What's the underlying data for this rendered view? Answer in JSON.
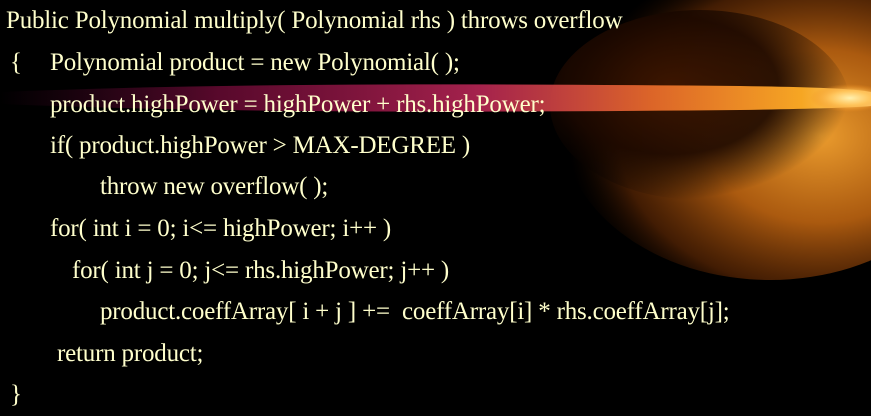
{
  "slide": {
    "colors": {
      "background": "#000000",
      "text": "#FFFFCC",
      "comet_core": "#FFD37A",
      "comet_mid": "#F39A1E",
      "comet_tail": "#B0125A"
    },
    "code_lines": [
      "Public Polynomial multiply( Polynomial rhs ) throws overflow",
      "{",
      "Polynomial product = new Polynomial( );",
      "product.highPower = highPower + rhs.highPower;",
      "if( product.highPower > MAX-DEGREE )",
      "throw new overflow( );",
      "for( int i = 0; i<= highPower; i++ )",
      "for( int j = 0; j<= rhs.highPower; j++ )",
      "product.coeffArray[ i + j ] +=  coeffArray[i] * rhs.coeffArray[j];",
      "return product;",
      "}"
    ]
  }
}
